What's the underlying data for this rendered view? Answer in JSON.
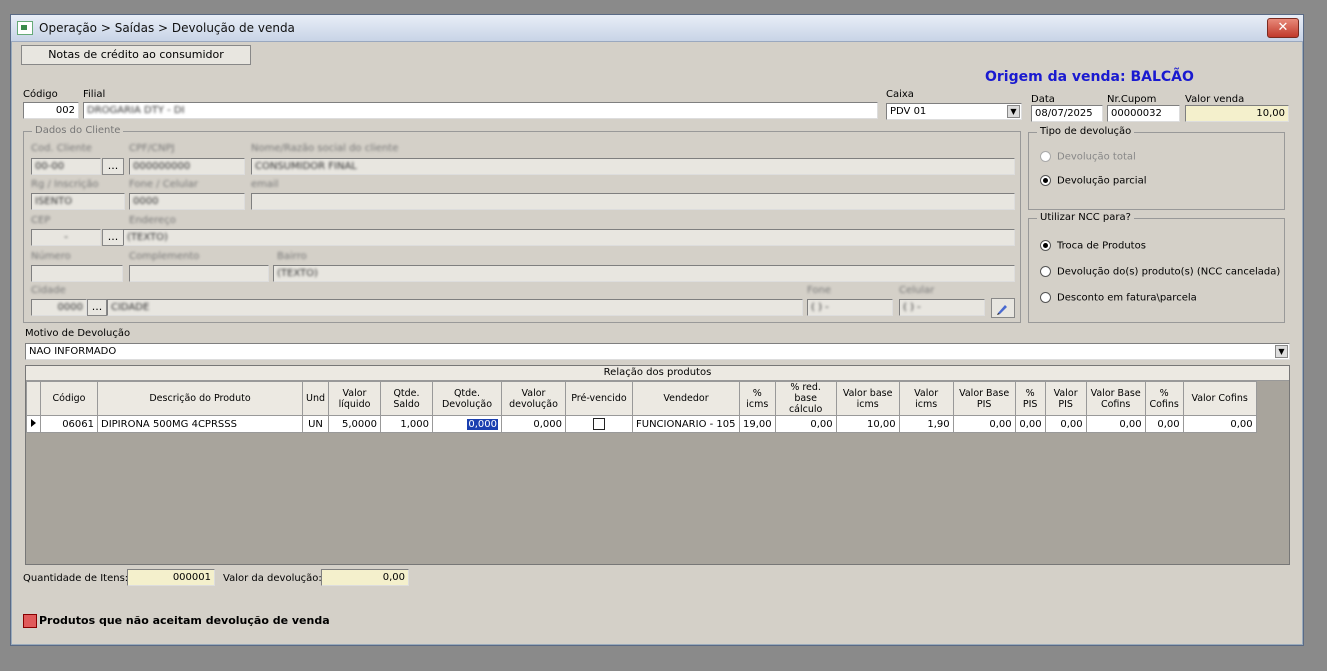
{
  "window": {
    "title": "Operação > Saídas > Devolução de venda",
    "close": "✕"
  },
  "toolbar": {
    "ncc_button": "Notas de crédito ao consumidor"
  },
  "origem": "Origem da venda: BALCÃO",
  "header": {
    "codigo_label": "Código",
    "codigo_value": "002",
    "filial_label": "Filial",
    "filial_value": "DROGARIA DTY - DI",
    "caixa_label": "Caixa",
    "caixa_value": "PDV 01",
    "data_label": "Data",
    "data_value": "08/07/2025",
    "cupom_label": "Nr.Cupom",
    "cupom_value": "00000032",
    "valor_venda_label": "Valor venda",
    "valor_venda_value": "10,00"
  },
  "cliente": {
    "group_label": "Dados do Cliente",
    "cod_cliente_label": "Cod. Cliente",
    "cod_cliente_value": "00-00",
    "cpf_label": "CPF/CNPJ",
    "cpf_value": "000000000",
    "nome_label": "Nome/Razão social do cliente",
    "nome_value": "CONSUMIDOR FINAL",
    "rg_label": "Rg / Inscrição",
    "rg_value": "ISENTO",
    "fone_label": "Fone / Celular",
    "fone_value": "0000",
    "email_label": "email",
    "cep_label": "CEP",
    "cep_value": "-",
    "endereco_label": "Endereço",
    "endereco_value": "(TEXTO)",
    "numero_label": "Número",
    "complemento_label": "Complemento",
    "bairro_label": "Bairro",
    "bairro_value": "(TEXTO)",
    "cidade_label": "Cidade",
    "cidade_cod": "0000",
    "cidade_value": "CIDADE",
    "fone2_label": "Fone",
    "fone2_value": "( )   -",
    "celular_label": "Celular",
    "celular_value": "( )   -"
  },
  "tipo_devolucao": {
    "label": "Tipo de devolução",
    "options": [
      "Devolução total",
      "Devolução parcial"
    ],
    "selected": 1
  },
  "utilizar_ncc": {
    "label": "Utilizar NCC para?",
    "options": [
      "Troca de Produtos",
      "Devolução do(s) produto(s) (NCC cancelada)",
      "Desconto em fatura\\parcela"
    ],
    "selected": 0
  },
  "motivo": {
    "label": "Motivo de Devolução",
    "value": "NAO INFORMADO"
  },
  "produtos": {
    "caption": "Relação dos produtos",
    "columns": [
      "Código",
      "Descrição do Produto",
      "Und",
      "Valor líquido",
      "Qtde. Saldo",
      "Qtde. Devolução",
      "Valor devolução",
      "Pré-vencido",
      "Vendedor",
      "% icms",
      "% red. base cálculo",
      "Valor base icms",
      "Valor icms",
      "Valor Base PIS",
      "% PIS",
      "Valor PIS",
      "Valor Base Cofins",
      "% Cofins",
      "Valor Cofins"
    ],
    "rows": [
      [
        "06061",
        "DIPIRONA 500MG  4CPRSSS",
        "UN",
        "5,0000",
        "1,000",
        "0,000",
        "0,000",
        "",
        "FUNCIONARIO - 105",
        "19,00",
        "0,00",
        "10,00",
        "1,90",
        "0,00",
        "0,00",
        "0,00",
        "0,00",
        "0,00",
        "0,00"
      ]
    ]
  },
  "footer": {
    "qtd_itens_label": "Quantidade de Itens:",
    "qtd_itens_value": "000001",
    "valor_dev_label": "Valor da devolução:",
    "valor_dev_value": "0,00",
    "legend": "Produtos que não aceitam devolução de venda"
  },
  "colors": {
    "origem": "#1a1ad0",
    "legend": "#e05a5a",
    "selection": "#1a3fb0"
  }
}
